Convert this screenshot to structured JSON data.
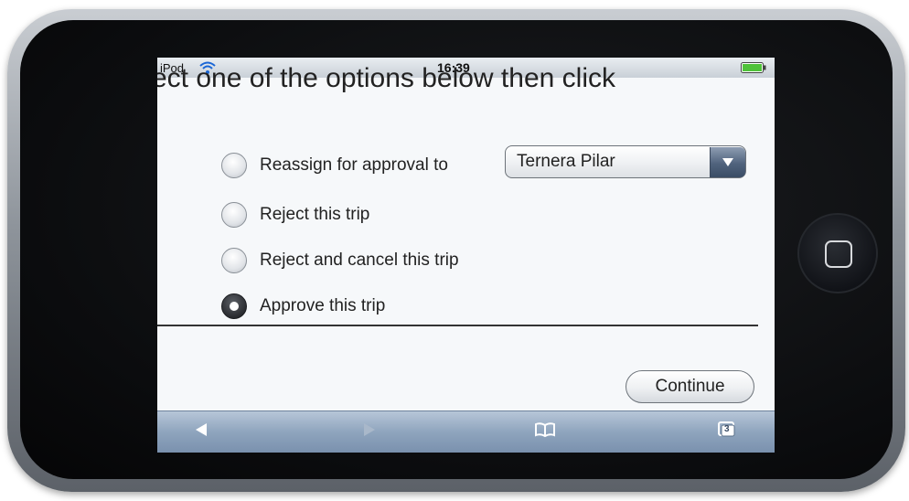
{
  "status_bar": {
    "carrier": "iPod",
    "time": "16:39"
  },
  "page": {
    "instruction": "ect one of the options below then click",
    "options": [
      {
        "label": "Reassign for approval to",
        "checked": false
      },
      {
        "label": "Reject this trip",
        "checked": false
      },
      {
        "label": "Reject and cancel this trip",
        "checked": false
      },
      {
        "label": "Approve this trip",
        "checked": true
      }
    ],
    "approver_select": {
      "value": "Ternera Pilar"
    },
    "continue_label": "Continue"
  },
  "toolbar": {
    "tabs_count": "3",
    "icons": [
      "back-arrow-icon",
      "forward-arrow-icon",
      "bookmarks-icon",
      "pages-icon"
    ]
  },
  "colors": {
    "toolbar": "#8ea4bd",
    "status_bar": "#d5dbe1",
    "battery": "#4fc23a"
  }
}
